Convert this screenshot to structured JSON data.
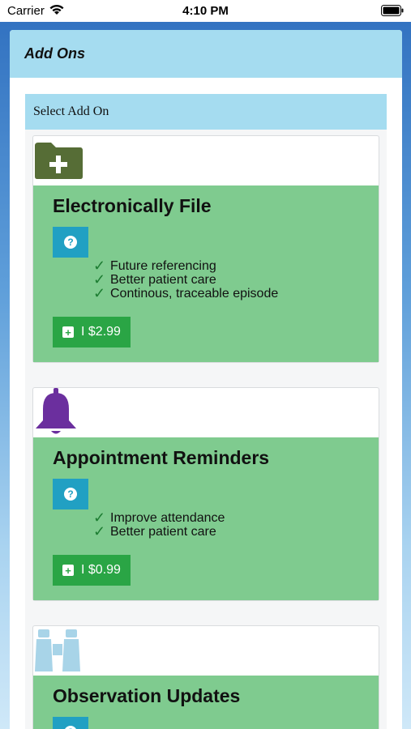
{
  "status_bar": {
    "carrier": "Carrier",
    "time": "4:10 PM"
  },
  "header": {
    "title": "Add Ons"
  },
  "section": {
    "title": "Select Add On"
  },
  "addons": [
    {
      "title": "Electronically File",
      "icon": "folder-plus-icon",
      "icon_color": "#566d36",
      "features": [
        "Future referencing",
        "Better patient care",
        "Continous, traceable episode"
      ],
      "price_label": "I $2.99"
    },
    {
      "title": "Appointment Reminders",
      "icon": "bell-icon",
      "icon_color": "#6b2f9e",
      "features": [
        "Improve attendance",
        "Better patient care"
      ],
      "price_label": "I $0.99"
    },
    {
      "title": "Observation Updates",
      "icon": "binoculars-icon",
      "icon_color": "#a8d4e8",
      "features": [],
      "price_label": ""
    }
  ],
  "colors": {
    "accent_blue": "#a5dcf0",
    "card_green": "#7fcb8f",
    "button_green": "#2aa545",
    "help_blue": "#21a0c3"
  }
}
